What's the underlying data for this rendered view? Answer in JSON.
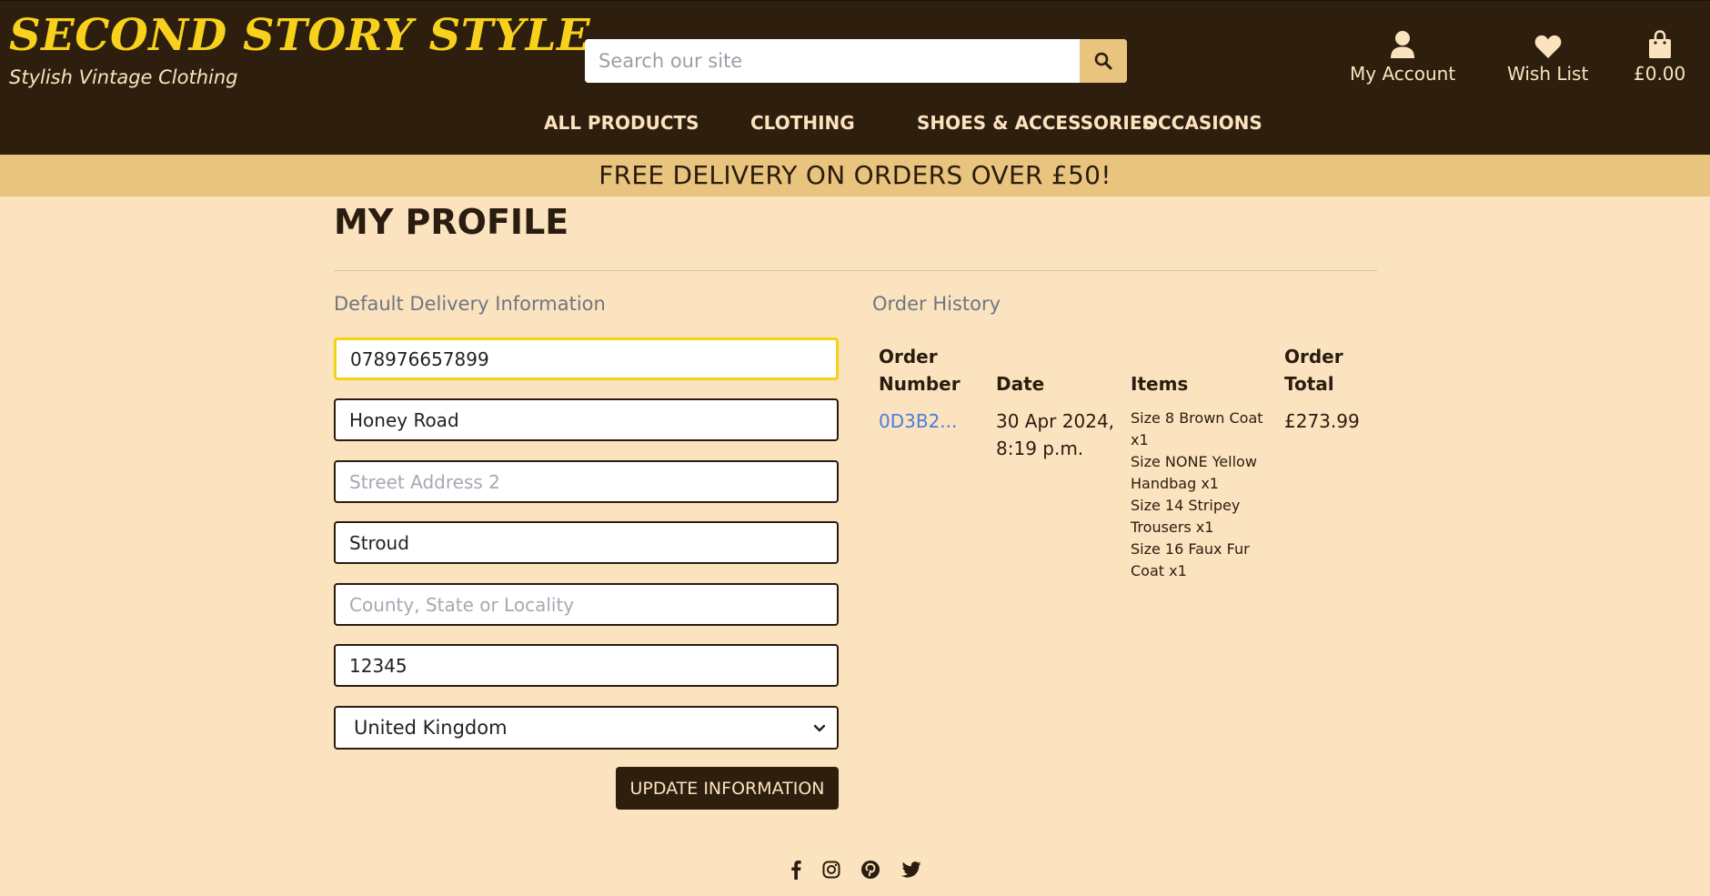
{
  "brand": {
    "title": "SECOND STORY STYLE",
    "tagline": "Stylish Vintage Clothing",
    "colors": {
      "header": "#2e1e0d",
      "accent": "#f7d11b",
      "banner": "#e8c47f",
      "page": "#fbe3c0",
      "link": "#4a7de0"
    }
  },
  "search": {
    "placeholder": "Search our site",
    "icon": "search-icon"
  },
  "header_links": {
    "account": {
      "label": "My Account",
      "icon": "user-icon"
    },
    "wishlist": {
      "label": "Wish List",
      "icon": "heart-icon"
    },
    "bag": {
      "label": "£0.00",
      "icon": "shopping-bag-icon"
    }
  },
  "nav": {
    "all_products": "ALL PRODUCTS",
    "clothing": "CLOTHING",
    "shoes": "SHOES & ACCESSORIES",
    "occasions": "OCCASIONS"
  },
  "banner": "FREE DELIVERY ON ORDERS OVER £50!",
  "profile": {
    "title": "MY PROFILE",
    "delivery_label": "Default Delivery Information",
    "fields": {
      "phone": {
        "value": "078976657899",
        "placeholder": ""
      },
      "street1": {
        "value": "Honey Road",
        "placeholder": ""
      },
      "street2": {
        "value": "",
        "placeholder": "Street Address 2"
      },
      "town": {
        "value": "Stroud",
        "placeholder": ""
      },
      "county": {
        "value": "",
        "placeholder": "County, State or Locality"
      },
      "postcode": {
        "value": "12345",
        "placeholder": ""
      }
    },
    "country": "United Kingdom",
    "update_label": "UPDATE INFORMATION"
  },
  "orders": {
    "label": "Order History",
    "headers": {
      "number_1": "Order",
      "number_2": "Number",
      "date": "Date",
      "items": "Items",
      "total_1": "Order",
      "total_2": "Total"
    },
    "rows": [
      {
        "number": "0D3B2...",
        "date_1": "30 Apr 2024,",
        "date_2": "8:19 p.m.",
        "items": [
          "Size 8 Brown Coat x1",
          "Size NONE Yellow Handbag x1",
          "Size 14 Stripey Trousers x1",
          "Size 16 Faux Fur Coat x1"
        ],
        "total": "£273.99"
      }
    ]
  },
  "social": [
    "facebook-icon",
    "instagram-icon",
    "pinterest-icon",
    "twitter-icon"
  ]
}
